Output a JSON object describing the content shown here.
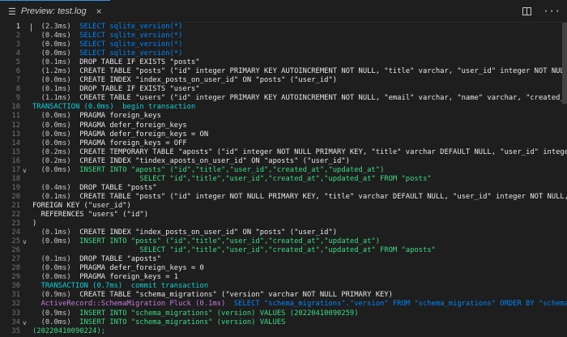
{
  "tab": {
    "title": "Preview: test.log",
    "close": "×"
  },
  "toolbar": {
    "more": "···"
  },
  "lines": [
    {
      "num": "1",
      "fold": "",
      "segs": [
        [
          "tm",
          "  (2.3ms)  "
        ],
        [
          "sb",
          "SELECT sqlite_version(*)"
        ]
      ]
    },
    {
      "num": "2",
      "fold": "",
      "segs": [
        [
          "tm",
          "  (0.4ms)  "
        ],
        [
          "sb",
          "SELECT sqlite_version(*)"
        ]
      ]
    },
    {
      "num": "3",
      "fold": "",
      "segs": [
        [
          "tm",
          "  (0.0ms)  "
        ],
        [
          "sb",
          "SELECT sqlite_version(*)"
        ]
      ]
    },
    {
      "num": "4",
      "fold": "",
      "segs": [
        [
          "tm",
          "  (0.0ms)  "
        ],
        [
          "sb",
          "SELECT sqlite_version(*)"
        ]
      ]
    },
    {
      "num": "5",
      "fold": "",
      "segs": [
        [
          "tm",
          "  (0.1ms)  "
        ],
        [
          "tb",
          "DROP TABLE IF EXISTS \"posts\""
        ]
      ]
    },
    {
      "num": "6",
      "fold": "",
      "segs": [
        [
          "tm",
          "  (1.2ms)  "
        ],
        [
          "tb",
          "CREATE TABLE \"posts\" (\"id\" integer PRIMARY KEY AUTOINCREMENT NOT NULL, \"title\" varchar, \"user_id\" integer NOT NULL, \"created_at\" datet"
        ]
      ]
    },
    {
      "num": "7",
      "fold": "",
      "segs": [
        [
          "tm",
          "  (0.0ms)  "
        ],
        [
          "tb",
          "CREATE INDEX \"index_posts_on_user_id\" ON \"posts\" (\"user_id\")"
        ]
      ]
    },
    {
      "num": "8",
      "fold": "",
      "segs": [
        [
          "tm",
          "  (0.1ms)  "
        ],
        [
          "tb",
          "DROP TABLE IF EXISTS \"users\""
        ]
      ]
    },
    {
      "num": "9",
      "fold": "",
      "segs": [
        [
          "tm",
          "  (1.1ms)  "
        ],
        [
          "tb",
          "CREATE TABLE \"users\" (\"id\" integer PRIMARY KEY AUTOINCREMENT NOT NULL, \"email\" varchar, \"name\" varchar, \"created_at\" datetime(6) NOT"
        ]
      ]
    },
    {
      "num": "10",
      "fold": "",
      "segs": [
        [
          "sc",
          "TRANSACTION (0.0ms)  "
        ],
        [
          "sc",
          "begin transaction"
        ]
      ]
    },
    {
      "num": "11",
      "fold": "",
      "segs": [
        [
          "tm",
          "  (0.0ms)  "
        ],
        [
          "tb",
          "PRAGMA foreign_keys"
        ]
      ]
    },
    {
      "num": "12",
      "fold": "",
      "segs": [
        [
          "tm",
          "  (0.0ms)  "
        ],
        [
          "tb",
          "PRAGMA defer_foreign_keys"
        ]
      ]
    },
    {
      "num": "13",
      "fold": "",
      "segs": [
        [
          "tm",
          "  (0.0ms)  "
        ],
        [
          "tb",
          "PRAGMA defer_foreign_keys = ON"
        ]
      ]
    },
    {
      "num": "14",
      "fold": "",
      "segs": [
        [
          "tm",
          "  (0.0ms)  "
        ],
        [
          "tb",
          "PRAGMA foreign_keys = OFF"
        ]
      ]
    },
    {
      "num": "15",
      "fold": "",
      "segs": [
        [
          "tm",
          "  (0.2ms)  "
        ],
        [
          "tb",
          "CREATE TEMPORARY TABLE \"aposts\" (\"id\" integer NOT NULL PRIMARY KEY, \"title\" varchar DEFAULT NULL, \"user_id\" integer NOT NULL, \"creat"
        ]
      ]
    },
    {
      "num": "16",
      "fold": "",
      "segs": [
        [
          "tm",
          "  (0.2ms)  "
        ],
        [
          "tb",
          "CREATE INDEX \"tindex_aposts_on_user_id\" ON \"aposts\" (\"user_id\")"
        ]
      ]
    },
    {
      "num": "17",
      "fold": "v",
      "segs": [
        [
          "tm",
          "  (0.0ms)  "
        ],
        [
          "sg",
          "INSERT INTO \"aposts\" (\"id\",\"title\",\"user_id\",\"created_at\",\"updated_at\")"
        ]
      ]
    },
    {
      "num": "18",
      "fold": "",
      "segs": [
        [
          "sg",
          "                         SELECT \"id\",\"title\",\"user_id\",\"created_at\",\"updated_at\" FROM \"posts\""
        ]
      ]
    },
    {
      "num": "19",
      "fold": "",
      "segs": [
        [
          "tm",
          "  (0.4ms)  "
        ],
        [
          "tb",
          "DROP TABLE \"posts\""
        ]
      ]
    },
    {
      "num": "20",
      "fold": "",
      "segs": [
        [
          "tm",
          "  (0.1ms)  "
        ],
        [
          "tb",
          "CREATE TABLE \"posts\" (\"id\" integer NOT NULL PRIMARY KEY, \"title\" varchar DEFAULT NULL, \"user_id\" integer NOT NULL, \"created_at\" datet"
        ]
      ]
    },
    {
      "num": "21",
      "fold": "",
      "segs": [
        [
          "tb",
          "FOREIGN KEY (\"user_id\")"
        ]
      ]
    },
    {
      "num": "22",
      "fold": "",
      "segs": [
        [
          "tb",
          "  REFERENCES \"users\" (\"id\")"
        ]
      ]
    },
    {
      "num": "23",
      "fold": "",
      "segs": [
        [
          "tb",
          ")"
        ]
      ]
    },
    {
      "num": "24",
      "fold": "",
      "segs": [
        [
          "tm",
          "  (0.1ms)  "
        ],
        [
          "tb",
          "CREATE INDEX \"index_posts_on_user_id\" ON \"posts\" (\"user_id\")"
        ]
      ]
    },
    {
      "num": "25",
      "fold": "v",
      "segs": [
        [
          "tm",
          "  (0.0ms)  "
        ],
        [
          "sg",
          "INSERT INTO \"posts\" (\"id\",\"title\",\"user_id\",\"created_at\",\"updated_at\")"
        ]
      ]
    },
    {
      "num": "26",
      "fold": "",
      "segs": [
        [
          "sg",
          "                         SELECT \"id\",\"title\",\"user_id\",\"created_at\",\"updated_at\" FROM \"aposts\""
        ]
      ]
    },
    {
      "num": "27",
      "fold": "",
      "segs": [
        [
          "tm",
          "  (0.1ms)  "
        ],
        [
          "tb",
          "DROP TABLE \"aposts\""
        ]
      ]
    },
    {
      "num": "28",
      "fold": "",
      "segs": [
        [
          "tm",
          "  (0.0ms)  "
        ],
        [
          "tb",
          "PRAGMA defer_foreign_keys = 0"
        ]
      ]
    },
    {
      "num": "29",
      "fold": "",
      "segs": [
        [
          "tm",
          "  (0.0ms)  "
        ],
        [
          "tb",
          "PRAGMA foreign_keys = 1"
        ]
      ]
    },
    {
      "num": "30",
      "fold": "",
      "segs": [
        [
          "sc",
          "  TRANSACTION (0.7ms)  "
        ],
        [
          "sc",
          "commit transaction"
        ]
      ]
    },
    {
      "num": "31",
      "fold": "",
      "segs": [
        [
          "tm",
          "  (0.9ms)  "
        ],
        [
          "tb",
          "CREATE TABLE \"schema_migrations\" (\"version\" varchar NOT NULL PRIMARY KEY)"
        ]
      ]
    },
    {
      "num": "32",
      "fold": "",
      "segs": [
        [
          "sm",
          "  ActiveRecord::SchemaMigration Pluck (0.1ms)  "
        ],
        [
          "sb",
          "SELECT \"schema_migrations\".\"version\" FROM \"schema_migrations\" ORDER BY \"schema_migrations\".\"versio"
        ]
      ]
    },
    {
      "num": "33",
      "fold": "",
      "segs": [
        [
          "tm",
          "  (0.9ms)  "
        ],
        [
          "sg",
          "INSERT INTO \"schema_migrations\" (version) VALUES (20220410090259)"
        ]
      ]
    },
    {
      "num": "34",
      "fold": "v",
      "segs": [
        [
          "tm",
          "  (0.0ms)  "
        ],
        [
          "sg",
          "INSERT INTO \"schema_migrations\" (version) VALUES"
        ]
      ]
    },
    {
      "num": "35",
      "fold": "",
      "segs": [
        [
          "sg",
          "(20220410090224);"
        ]
      ]
    }
  ],
  "colors": {
    "background": "#1e1e1e",
    "sql_select": "#0085ff",
    "sql_transaction": "#11d1d6",
    "sql_insert": "#3ddc84",
    "active_record": "#c678dd"
  }
}
